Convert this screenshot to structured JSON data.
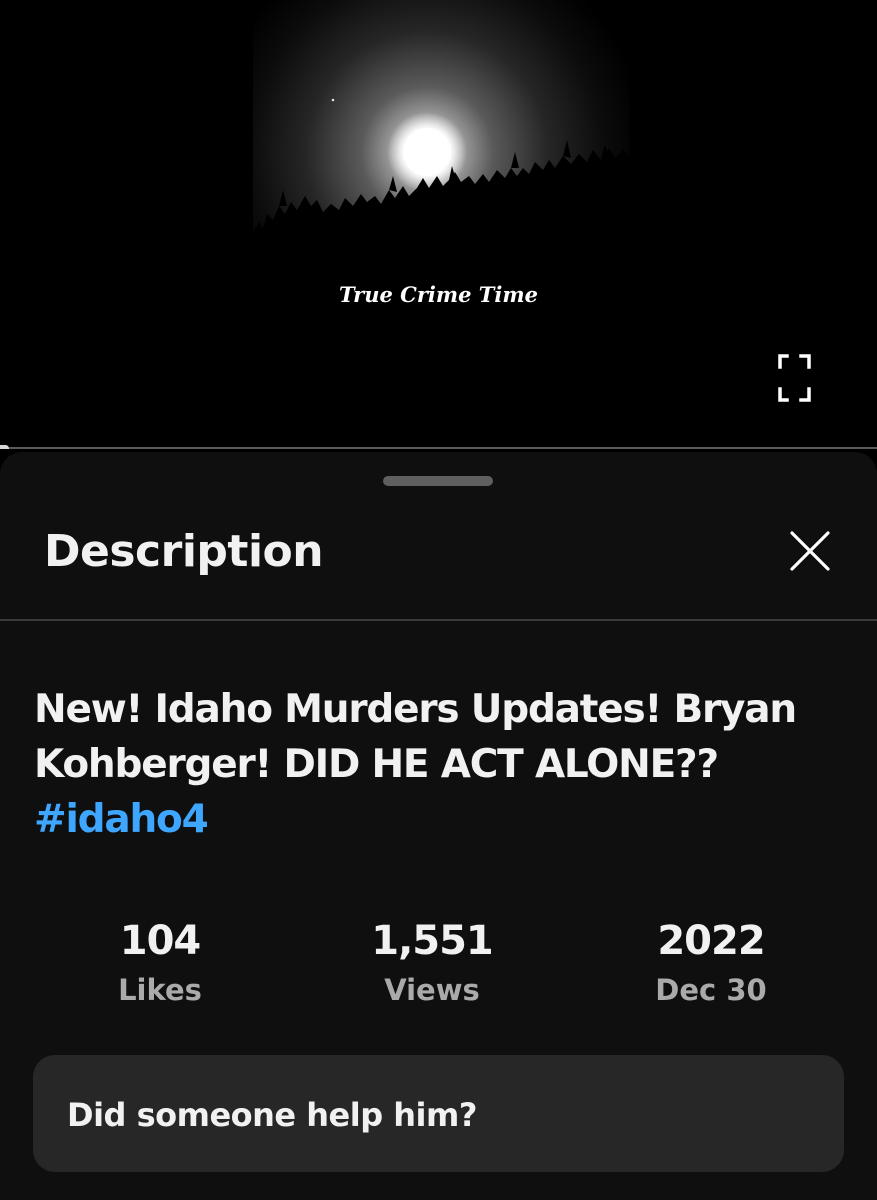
{
  "player": {
    "video_caption": "True Crime Time",
    "fullscreen_icon": "fullscreen-icon",
    "progress": 0.01
  },
  "description_panel": {
    "title": "Description",
    "close_icon": "close-icon",
    "video_title": "New! Idaho Murders Updates! Bryan Kohberger! DID HE ACT ALONE??",
    "hashtag": "#idaho4",
    "stats": [
      {
        "value": "104",
        "label": "Likes"
      },
      {
        "value": "1,551",
        "label": "Views"
      },
      {
        "value": "2022",
        "label": "Dec 30"
      }
    ],
    "description_text": "Did someone help him?"
  },
  "colors": {
    "background": "#0f0f0f",
    "hashtag_link": "#3ea6ff",
    "secondary_text": "#aaaaaa",
    "card": "#272727"
  }
}
